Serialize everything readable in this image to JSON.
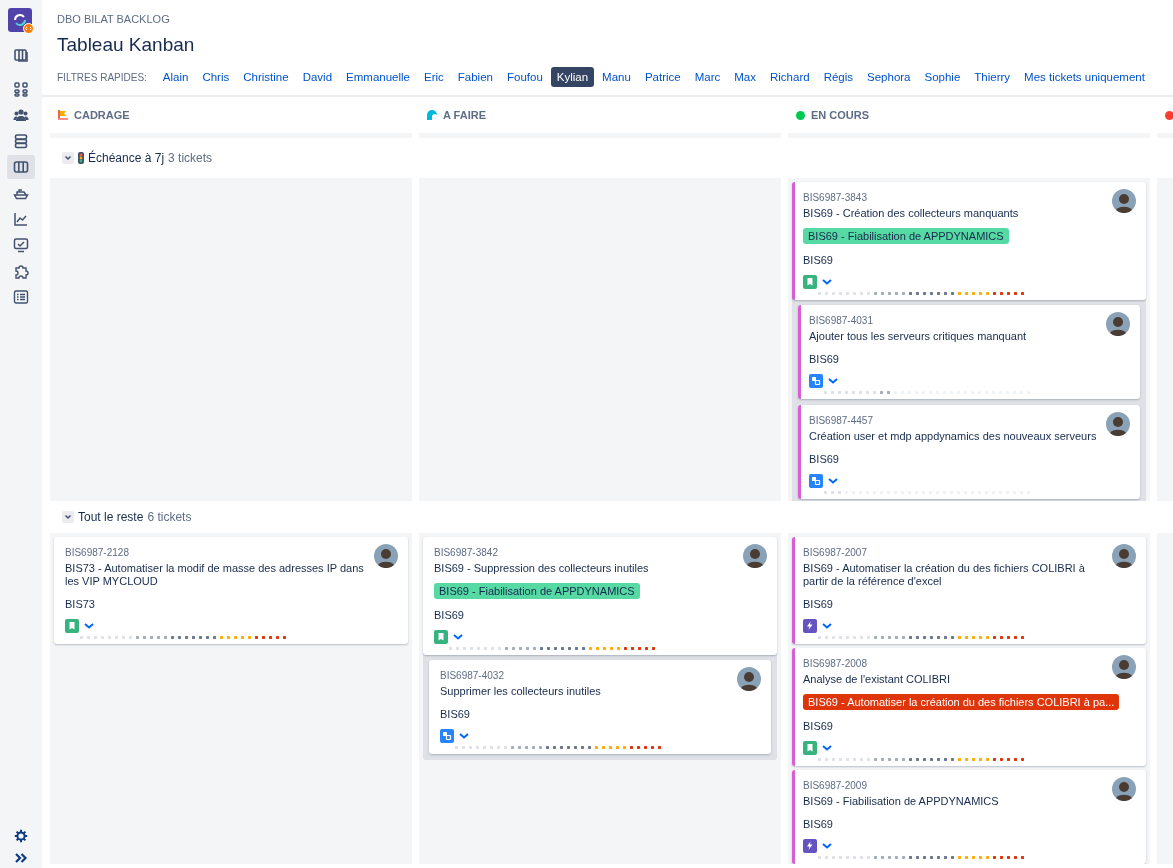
{
  "sidebar": {
    "items": [
      {
        "kind": "boards",
        "selected": false
      },
      {
        "kind": "grid",
        "selected": false
      },
      {
        "kind": "people",
        "selected": false
      },
      {
        "kind": "stack",
        "selected": false
      },
      {
        "kind": "columns",
        "selected": true
      },
      {
        "kind": "ship",
        "selected": false
      },
      {
        "kind": "chart",
        "selected": false
      },
      {
        "kind": "monitor",
        "selected": false
      },
      {
        "kind": "puzzle",
        "selected": false
      },
      {
        "kind": "list",
        "selected": false
      }
    ],
    "footer_items": [
      {
        "kind": "settings"
      },
      {
        "kind": "expand"
      }
    ]
  },
  "header": {
    "breadcrumb": "DBO BILAT BACKLOG",
    "title": "Tableau Kanban",
    "quick_filters_label": "FILTRES RAPIDES:",
    "quick_filters": [
      {
        "label": "Alain",
        "selected": false
      },
      {
        "label": "Chris",
        "selected": false
      },
      {
        "label": "Christine",
        "selected": false
      },
      {
        "label": "David",
        "selected": false
      },
      {
        "label": "Emmanuelle",
        "selected": false
      },
      {
        "label": "Eric",
        "selected": false
      },
      {
        "label": "Fabien",
        "selected": false
      },
      {
        "label": "Foufou",
        "selected": false
      },
      {
        "label": "Kylian",
        "selected": true
      },
      {
        "label": "Manu",
        "selected": false
      },
      {
        "label": "Patrice",
        "selected": false
      },
      {
        "label": "Marc",
        "selected": false
      },
      {
        "label": "Max",
        "selected": false
      },
      {
        "label": "Richard",
        "selected": false
      },
      {
        "label": "Régis",
        "selected": false
      },
      {
        "label": "Sephora",
        "selected": false
      },
      {
        "label": "Sophie",
        "selected": false
      },
      {
        "label": "Thierry",
        "selected": false
      },
      {
        "label": "Mes tickets uniquement",
        "selected": false
      }
    ]
  },
  "columns": [
    {
      "title": "CADRAGE",
      "kind": "flag"
    },
    {
      "title": "A FAIRE",
      "kind": "wave"
    },
    {
      "title": "EN COURS",
      "kind": "dot",
      "color": "#00c853"
    },
    {
      "kind": "dot",
      "color": "#ff3b30"
    }
  ],
  "swimlanes": [
    {
      "label": "Échéance à 7j",
      "count": "3 tickets",
      "expanded": true,
      "kind": "deadline",
      "cells": [
        [],
        [],
        [
          {
            "key": "BIS6987-3843",
            "summary": "BIS69 - Création des collecteurs manquants",
            "epic": {
              "label": "BIS69 - Fiabilisation de APPDYNAMICS",
              "color": "#57d9a3"
            },
            "project": "BIS69",
            "kind": "story",
            "level": 1,
            "color": "#d65fd3",
            "children": [
              {
                "key": "BIS6987-4031",
                "summary": "Ajouter tous les serveurs critiques manquant",
                "project": "BIS69",
                "kind": "subtask",
                "level": 0.34,
                "color": "#d65fd3"
              },
              {
                "key": "BIS6987-4457",
                "summary": "Création user et mdp appdynamics des nouveaux serveurs",
                "project": "BIS69",
                "kind": "subtask",
                "level": 0.1,
                "color": "#d65fd3"
              }
            ]
          }
        ]
      ]
    },
    {
      "label": "Tout le reste",
      "count": "6 tickets",
      "expanded": true,
      "kind": "plain",
      "cells": [
        [
          {
            "key": "BIS6987-2128",
            "summary": "BIS73 - Automatiser la modif de masse des adresses IP dans les VIP MYCLOUD",
            "project": "BIS73",
            "kind": "story",
            "level": 1
          }
        ],
        [
          {
            "key": "BIS6987-3842",
            "summary": "BIS69 - Suppression des collecteurs inutiles",
            "epic": {
              "label": "BIS69 - Fiabilisation de APPDYNAMICS",
              "color": "#57d9a3"
            },
            "project": "BIS69",
            "kind": "story",
            "level": 1,
            "children": [
              {
                "key": "BIS6987-4032",
                "summary": "Supprimer les collecteurs inutiles",
                "project": "BIS69",
                "kind": "subtask",
                "level": 1
              }
            ]
          }
        ],
        [
          {
            "key": "BIS6987-2007",
            "summary": "BIS69 - Automatiser la création du des fichiers COLIBRI à partir de la référence d'excel",
            "project": "BIS69",
            "kind": "bolt",
            "level": 1,
            "color": "#d65fd3"
          },
          {
            "key": "BIS6987-2008",
            "summary": "Analyse de l'existant COLIBRI",
            "epic": {
              "label": "BIS69 - Automatiser la création du des fichiers COLIBRI à pa...",
              "color": "#de350b"
            },
            "project": "BIS69",
            "kind": "story",
            "level": 1,
            "color": "#d65fd3"
          },
          {
            "key": "BIS6987-2009",
            "summary": "BIS69 - Fiabilisation de APPDYNAMICS",
            "project": "BIS69",
            "kind": "bolt",
            "level": 1,
            "color": "#d65fd3"
          }
        ]
      ]
    }
  ]
}
